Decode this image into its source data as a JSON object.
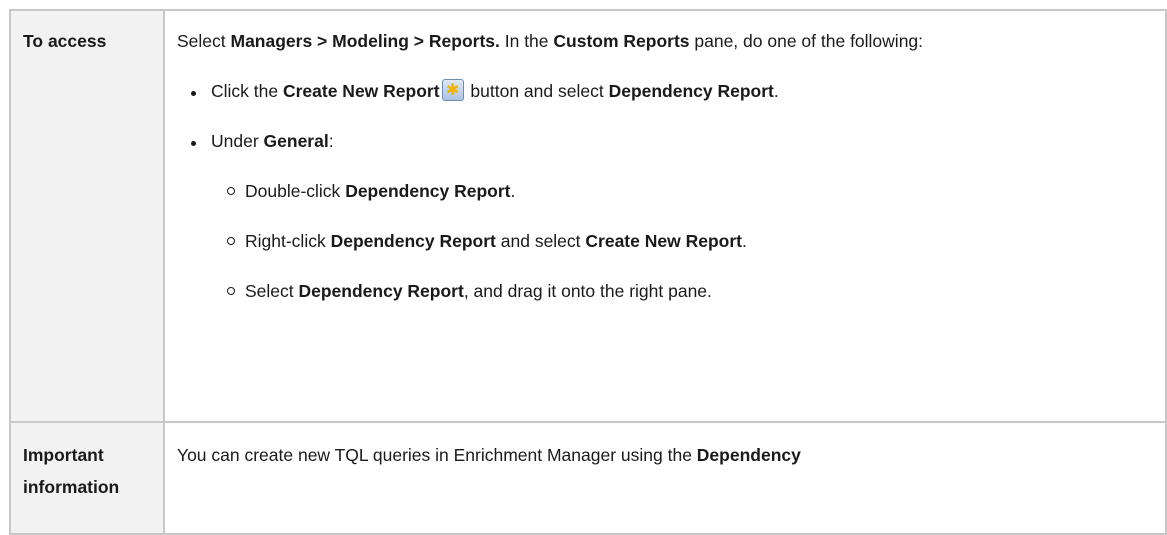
{
  "table": {
    "access": {
      "header": "To access",
      "intro": {
        "t1": "Select ",
        "b1": "Managers > Modeling > Reports.",
        "t2": " In the ",
        "b2": "Custom Reports",
        "t3": " pane, do one of the following:"
      },
      "bullet1": {
        "t1": "Click the ",
        "b1": "Create New Report",
        "icon": "create-new-report-icon",
        "t2": " button and select ",
        "b2": "Dependency Report",
        "t3": "."
      },
      "bullet2": {
        "t1": "Under ",
        "b1": "General",
        "t2": ":"
      },
      "sub1": {
        "t1": "Double-click ",
        "b1": "Dependency Report",
        "t2": "."
      },
      "sub2": {
        "t1": "Right-click ",
        "b1": "Dependency Report",
        "t2": " and select ",
        "b2": "Create New Report",
        "t3": "."
      },
      "sub3": {
        "t1": "Select ",
        "b1": "Dependency Report",
        "t2": ", and drag it onto the right pane."
      }
    },
    "info": {
      "header": "Important information",
      "t1": "You can create new TQL queries in Enrichment Manager using the ",
      "b1": "Dependency"
    }
  }
}
